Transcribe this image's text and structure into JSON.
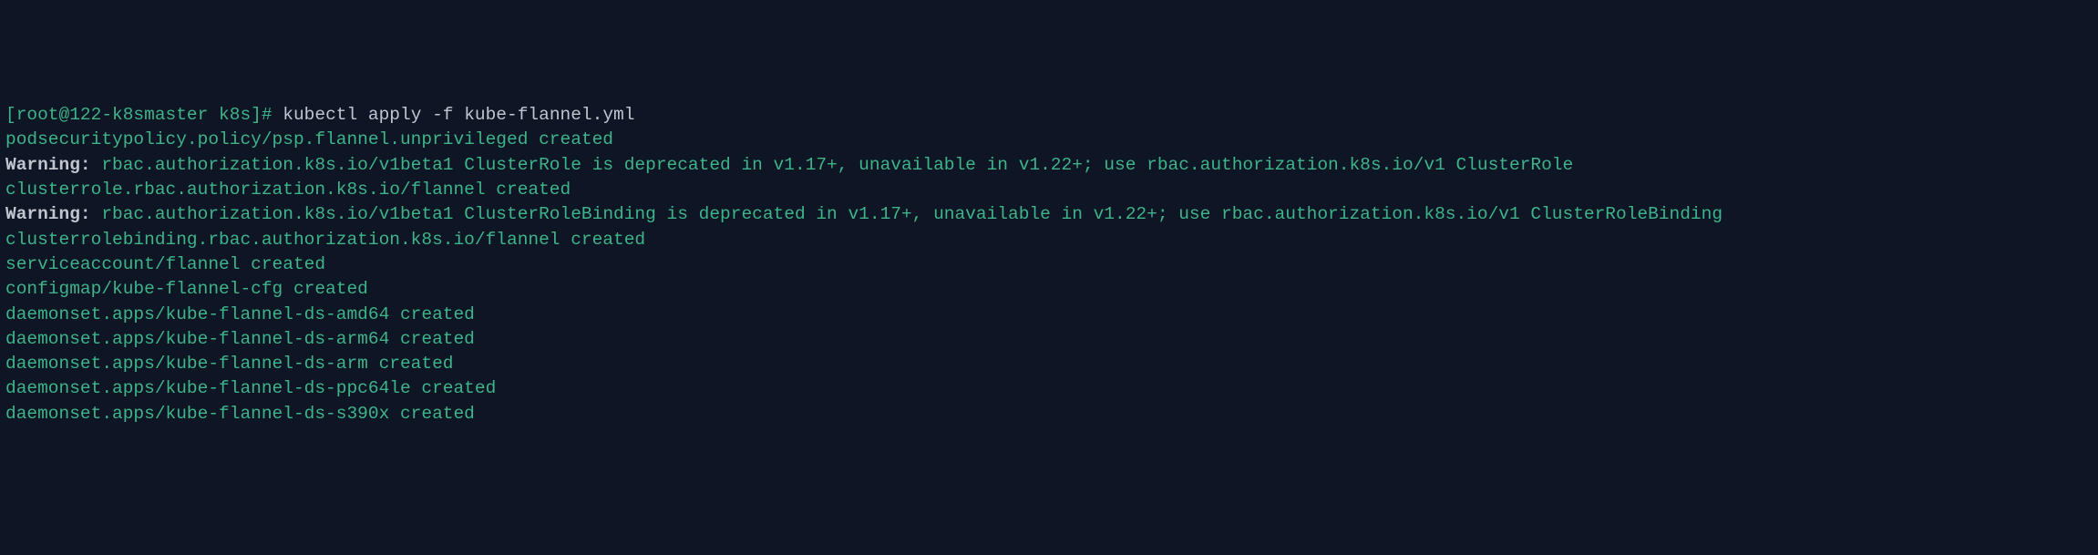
{
  "terminal": {
    "prompt": {
      "open_bracket": "[",
      "user_host": "root@122-k8smaster k8s",
      "close_bracket": "]# "
    },
    "command": "kubectl apply -f kube-flannel.yml",
    "lines": [
      {
        "type": "success",
        "text": "podsecuritypolicy.policy/psp.flannel.unprivileged created"
      },
      {
        "type": "warning",
        "label": "Warning: ",
        "text": "rbac.authorization.k8s.io/v1beta1 ClusterRole is deprecated in v1.17+, unavailable in v1.22+; use rbac.authorization.k8s.io/v1 ClusterRole"
      },
      {
        "type": "success",
        "text": "clusterrole.rbac.authorization.k8s.io/flannel created"
      },
      {
        "type": "warning",
        "label": "Warning: ",
        "text": "rbac.authorization.k8s.io/v1beta1 ClusterRoleBinding is deprecated in v1.17+, unavailable in v1.22+; use rbac.authorization.k8s.io/v1 ClusterRoleBinding"
      },
      {
        "type": "success",
        "text": "clusterrolebinding.rbac.authorization.k8s.io/flannel created"
      },
      {
        "type": "success",
        "text": "serviceaccount/flannel created"
      },
      {
        "type": "success",
        "text": "configmap/kube-flannel-cfg created"
      },
      {
        "type": "success",
        "text": "daemonset.apps/kube-flannel-ds-amd64 created"
      },
      {
        "type": "success",
        "text": "daemonset.apps/kube-flannel-ds-arm64 created"
      },
      {
        "type": "success",
        "text": "daemonset.apps/kube-flannel-ds-arm created"
      },
      {
        "type": "success",
        "text": "daemonset.apps/kube-flannel-ds-ppc64le created"
      },
      {
        "type": "success",
        "text": "daemonset.apps/kube-flannel-ds-s390x created"
      }
    ]
  }
}
